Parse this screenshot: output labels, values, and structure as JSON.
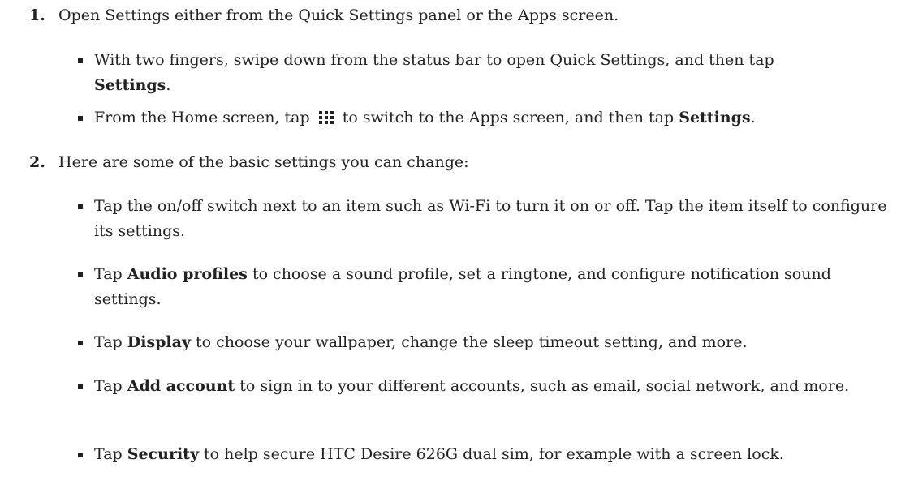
{
  "steps": [
    {
      "number": "1.",
      "text": "Open Settings either from the Quick Settings panel or the Apps screen.",
      "bullets": [
        {
          "pre": "With two fingers, swipe down from the status bar to open Quick Settings, and then tap",
          "bold": "Settings",
          "post": "."
        },
        {
          "pre": "From the Home screen, tap",
          "icon": "apps-grid-icon",
          "mid": "to switch to the Apps screen, and then tap",
          "bold": "Settings",
          "post": "."
        }
      ]
    },
    {
      "number": "2.",
      "text": "Here are some of the basic settings you can change:",
      "bullets": [
        {
          "pre": "Tap the on/off switch next to an item such as Wi-Fi to turn it on or off. Tap the item itself to configure its settings."
        },
        {
          "pre": "Tap",
          "bold": "Audio profiles",
          "post": "to choose a sound profile, set a ringtone, and configure notification sound settings."
        },
        {
          "pre": "Tap",
          "bold": "Display",
          "post": "to choose your wallpaper, change the sleep timeout setting, and more."
        },
        {
          "pre": "Tap",
          "bold": "Add account",
          "post": "to sign in to your different accounts, such as email, social network, and more."
        },
        {
          "pre": "Tap",
          "bold": "Security",
          "post": "to help secure HTC Desire 626G dual sim, for example with a screen lock."
        }
      ]
    }
  ]
}
